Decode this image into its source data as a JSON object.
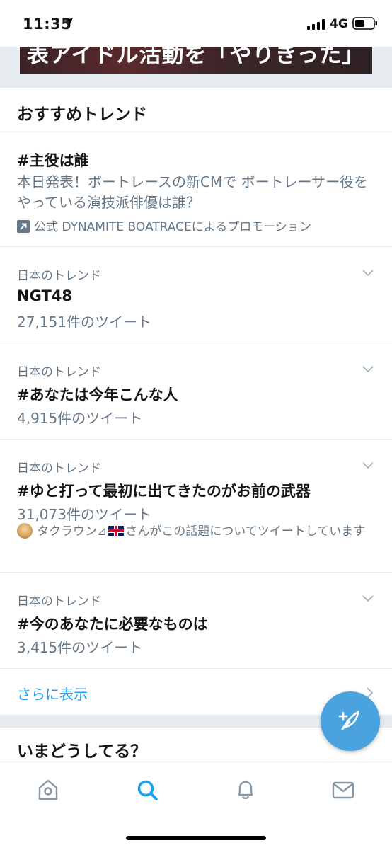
{
  "status_bar": {
    "time": "11:35",
    "network": "4G"
  },
  "banner": {
    "caption": "表アイドル活動を「やりきった」"
  },
  "trends": {
    "title": "おすすめトレンド",
    "promoted": {
      "name": "#主役は誰",
      "description": "本日発表！ボートレースの新CMで ボートレーサー役をやっている演技派俳優は誰？",
      "promo_text": "公式 DYNAMITE BOATRACEによるプロモーション"
    },
    "items": [
      {
        "context": "日本のトレンド",
        "name": "NGT48",
        "count": "27,151件のツイート"
      },
      {
        "context": "日本のトレンド",
        "name": "#あなたは今年こんな人",
        "count": "4,915件のツイート"
      },
      {
        "context": "日本のトレンド",
        "name": "#ゆと打って最初に出てきたのがお前の武器",
        "count": "31,073件のツイート",
        "mention_user": "タクラウン⊿",
        "mention_text": "さんがこの話題についてツイートしています"
      },
      {
        "context": "日本のトレンド",
        "name": "#今のあなたに必要なものは",
        "count": "3,415件のツイート"
      }
    ],
    "show_more": "さらに表示"
  },
  "whats_happening": {
    "title": "いまどうしてる？"
  },
  "colors": {
    "accent": "#1da1f2",
    "secondary_text": "#657786",
    "fab": "#4aa3df"
  },
  "icons": {
    "compose": "compose-feather-icon",
    "tabs": [
      "home-icon",
      "search-icon",
      "bell-icon",
      "mail-icon"
    ]
  }
}
